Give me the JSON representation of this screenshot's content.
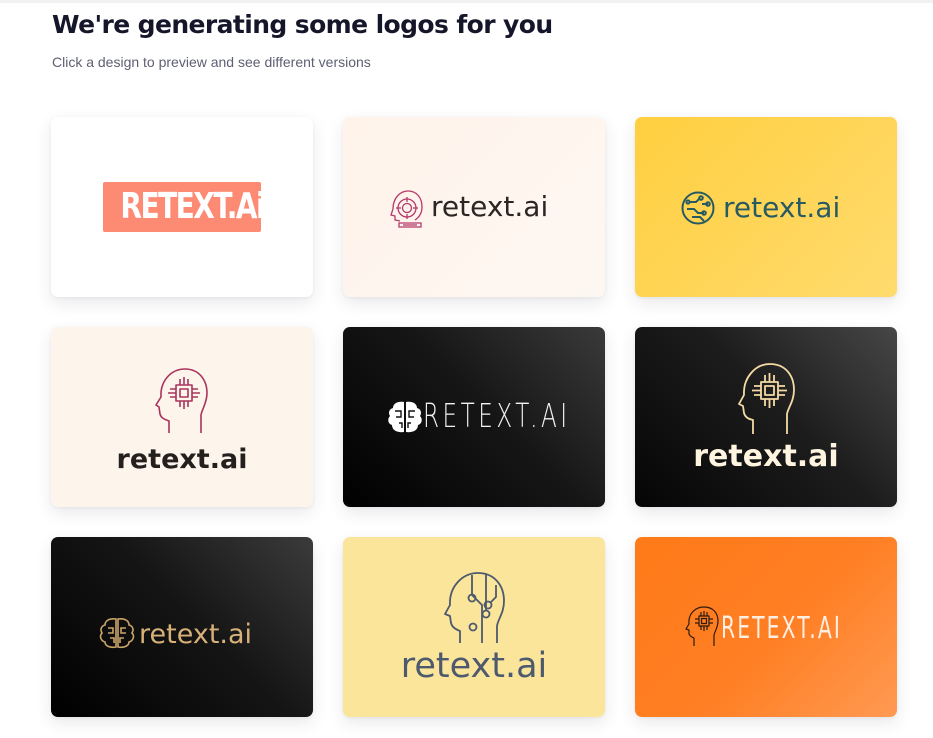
{
  "header": {
    "title": "We're generating some logos for you",
    "subtitle": "Click a design to preview and see different versions"
  },
  "logos": [
    {
      "text": "RETEXT.Ai",
      "icon": "none",
      "background": "#ffffff",
      "accent": "#fd8a72"
    },
    {
      "text": "retext.ai",
      "icon": "robot-face-icon",
      "background": "#fdf5ee",
      "accent": "#b5386a"
    },
    {
      "text": "retext.ai",
      "icon": "circuit-globe-icon",
      "background": "#ffd44f",
      "accent": "#285a62"
    },
    {
      "text": "retext.ai",
      "icon": "head-chip-icon",
      "background": "#fdf4ec",
      "accent": "#a8345c"
    },
    {
      "text": "RETEXT.AI",
      "icon": "brain-icon",
      "background": "#111111",
      "accent": "#ffffff"
    },
    {
      "text": "retext.ai",
      "icon": "head-chip-icon",
      "background": "#1a1a1a",
      "accent": "#f4d9a4"
    },
    {
      "text": "retext.ai",
      "icon": "brain-circuit-icon",
      "background": "#111111",
      "accent": "#d7b178"
    },
    {
      "text": "retext.ai",
      "icon": "head-circuit-icon",
      "background": "#fbe59b",
      "accent": "#4d5a6e"
    },
    {
      "text": "RETEXT.AI",
      "icon": "head-chip-icon",
      "background": "#ff7f24",
      "accent": "#ffeee2"
    }
  ]
}
